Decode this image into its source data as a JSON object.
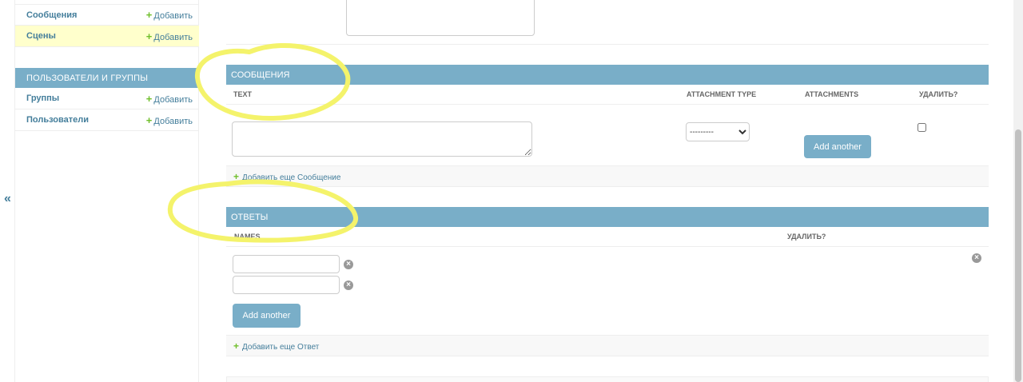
{
  "sidebar": {
    "items_top": [
      {
        "label": "Сообщения",
        "add": "Добавить"
      },
      {
        "label": "Сцены",
        "add": "Добавить"
      }
    ],
    "section_caption": "Пользователи и группы",
    "items_users": [
      {
        "label": "Группы",
        "add": "Добавить"
      },
      {
        "label": "Пользователи",
        "add": "Добавить"
      }
    ],
    "collapse_glyph": "«"
  },
  "messages_inline": {
    "title": "СООБЩЕНИЯ",
    "headers": {
      "text": "TEXT",
      "attachment_type": "ATTACHMENT TYPE",
      "attachments": "ATTACHMENTS",
      "delete": "УДАЛИТЬ?"
    },
    "attachment_type_value": "---------",
    "add_another_button": "Add another",
    "add_link": "Добавить еще Сообщение"
  },
  "answers_inline": {
    "title": "ОТВЕТЫ",
    "headers": {
      "names": "NAMES",
      "delete": "УДАЛИТЬ?"
    },
    "add_another_button": "Add another",
    "add_link": "Добавить еще Ответ"
  },
  "colors": {
    "header_blue": "#79aec8",
    "link_blue": "#447e9b",
    "add_green": "#70bf2b",
    "highlight_yellow": "#f4f36b"
  }
}
